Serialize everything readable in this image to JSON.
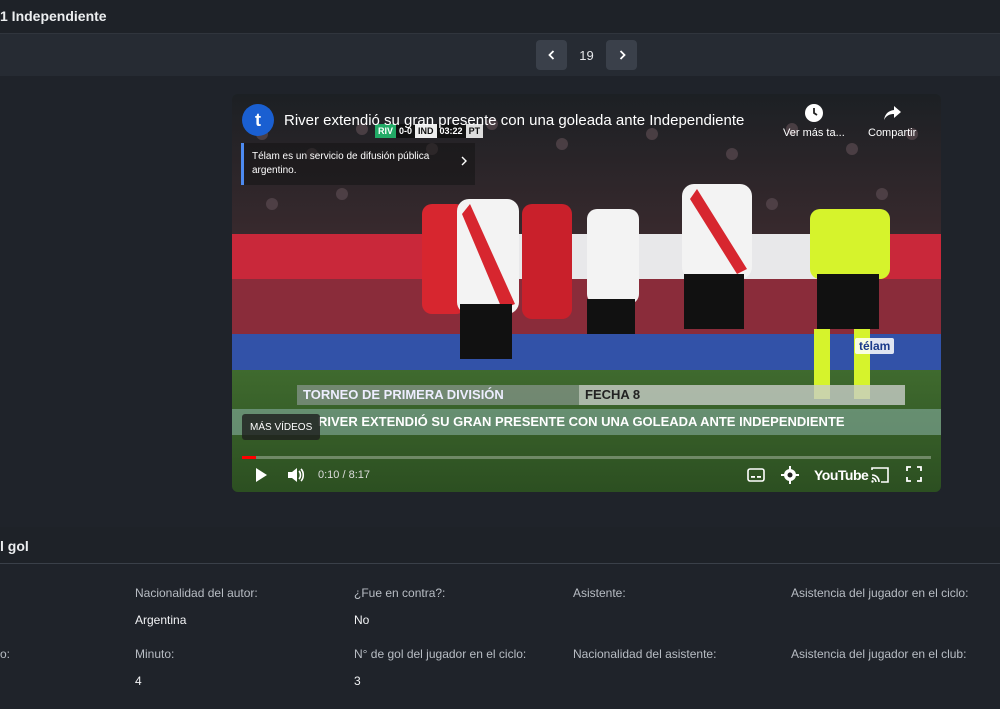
{
  "header": {
    "title": "1 Independiente"
  },
  "pager": {
    "current": "19"
  },
  "video": {
    "title": "River extendió su gran presente con una goleada ante Independiente",
    "channel_logo_letter": "t",
    "watch_later_label": "Ver más ta...",
    "share_label": "Compartir",
    "info_text": "Télam es un servicio de difusión pública argentino.",
    "more_videos_label": "MÁS VÍDEOS",
    "time": "0:10 / 8:17",
    "progress": 0.02,
    "youtube_label": "YouTube",
    "scoreboard": {
      "home": "RIV",
      "score": "0-0",
      "away": "IND",
      "clock": "03:22",
      "period": "PT"
    },
    "lower_third_left": "TORNEO DE PRIMERA DIVISIÓN",
    "lower_third_right": "FECHA 8",
    "ticker": "RIVER EXTENDIÓ SU GRAN PRESENTE CON UNA GOLEADA ANTE INDEPENDIENTE",
    "watermark": "télam",
    "accent_color": "#ff0000"
  },
  "goal_section": {
    "title": "l gol"
  },
  "fields": {
    "row1": [
      {
        "label": "Nacionalidad del autor:",
        "value": "Argentina"
      },
      {
        "label": "¿Fue en contra?:",
        "value": "No"
      },
      {
        "label": "Asistente:",
        "value": ""
      },
      {
        "label": "Asistencia del jugador en el ciclo:",
        "value": ""
      }
    ],
    "row2_partial_label": "o:",
    "row2": [
      {
        "label": "Minuto:",
        "value": "4"
      },
      {
        "label": "N° de gol del jugador en el ciclo:",
        "value": "3"
      },
      {
        "label": "Nacionalidad del asistente:",
        "value": ""
      },
      {
        "label": "Asistencia del jugador en el club:",
        "value": ""
      }
    ]
  }
}
